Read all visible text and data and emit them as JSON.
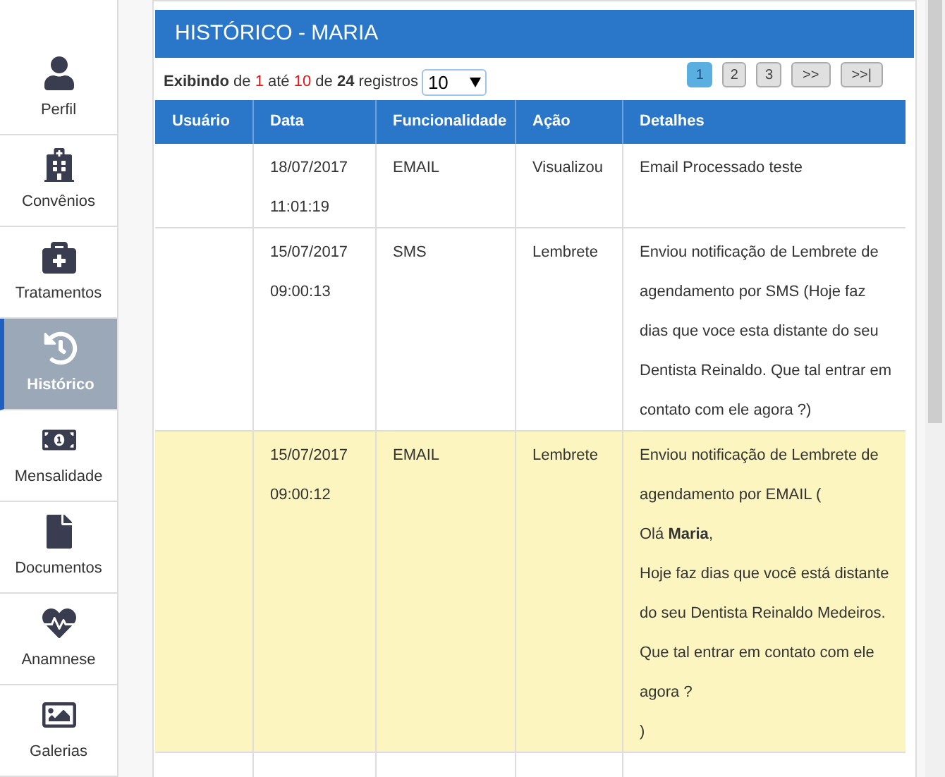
{
  "sidebar": {
    "items": [
      {
        "label": "Perfil",
        "selected": false
      },
      {
        "label": "Convênios",
        "selected": false
      },
      {
        "label": "Tratamentos",
        "selected": false
      },
      {
        "label": "Histórico",
        "selected": true
      },
      {
        "label": "Mensalidade",
        "selected": false
      },
      {
        "label": "Documentos",
        "selected": false
      },
      {
        "label": "Anamnese",
        "selected": false
      },
      {
        "label": "Galerias",
        "selected": false
      }
    ]
  },
  "panel": {
    "title": "HISTÓRICO - MARIA",
    "info": [
      {
        "text": "Exibindo",
        "kind": "bold"
      },
      {
        "text": " de ",
        "kind": "plain"
      },
      {
        "text": "1",
        "kind": "highlight"
      },
      {
        "text": " até ",
        "kind": "plain"
      },
      {
        "text": "10",
        "kind": "highlight"
      },
      {
        "text": " de ",
        "kind": "plain"
      },
      {
        "text": "24",
        "kind": "bold"
      },
      {
        "text": " registros",
        "kind": "plain"
      }
    ],
    "page_size": "10",
    "pagination": [
      {
        "label": "1",
        "selected": true
      },
      {
        "label": "2",
        "selected": false
      },
      {
        "label": "3",
        "selected": false
      },
      {
        "label": ">>",
        "selected": false
      },
      {
        "label": ">>|",
        "selected": false
      }
    ],
    "table": {
      "columns": [
        "Usuário",
        "Data",
        "Funcionalidade",
        "Ação",
        "Detalhes"
      ],
      "rows": [
        {
          "highlighted": false,
          "user": "",
          "date": "18/07/2017",
          "time": "11:01:19",
          "feature": "EMAIL",
          "action": "Visualizou",
          "details": [
            "Email Processado teste"
          ]
        },
        {
          "highlighted": false,
          "user": "",
          "date": "15/07/2017",
          "time": "09:00:13",
          "feature": "SMS",
          "action": "Lembrete",
          "details": [
            "Enviou notificação de Lembrete de agendamento por SMS (Hoje faz dias que voce esta distante do seu Dentista Reinaldo. Que tal entrar em contato com ele agora ?)"
          ]
        },
        {
          "highlighted": true,
          "user": "",
          "date": "15/07/2017",
          "time": "09:00:12",
          "feature": "EMAIL",
          "action": "Lembrete",
          "details": [
            "Enviou notificação de Lembrete de agendamento por EMAIL (",
            "Olá **Maria**,",
            "Hoje faz dias que você está distante do seu Dentista Reinaldo Medeiros.",
            "Que tal entrar em contato com ele agora ?",
            ")"
          ]
        }
      ]
    }
  }
}
